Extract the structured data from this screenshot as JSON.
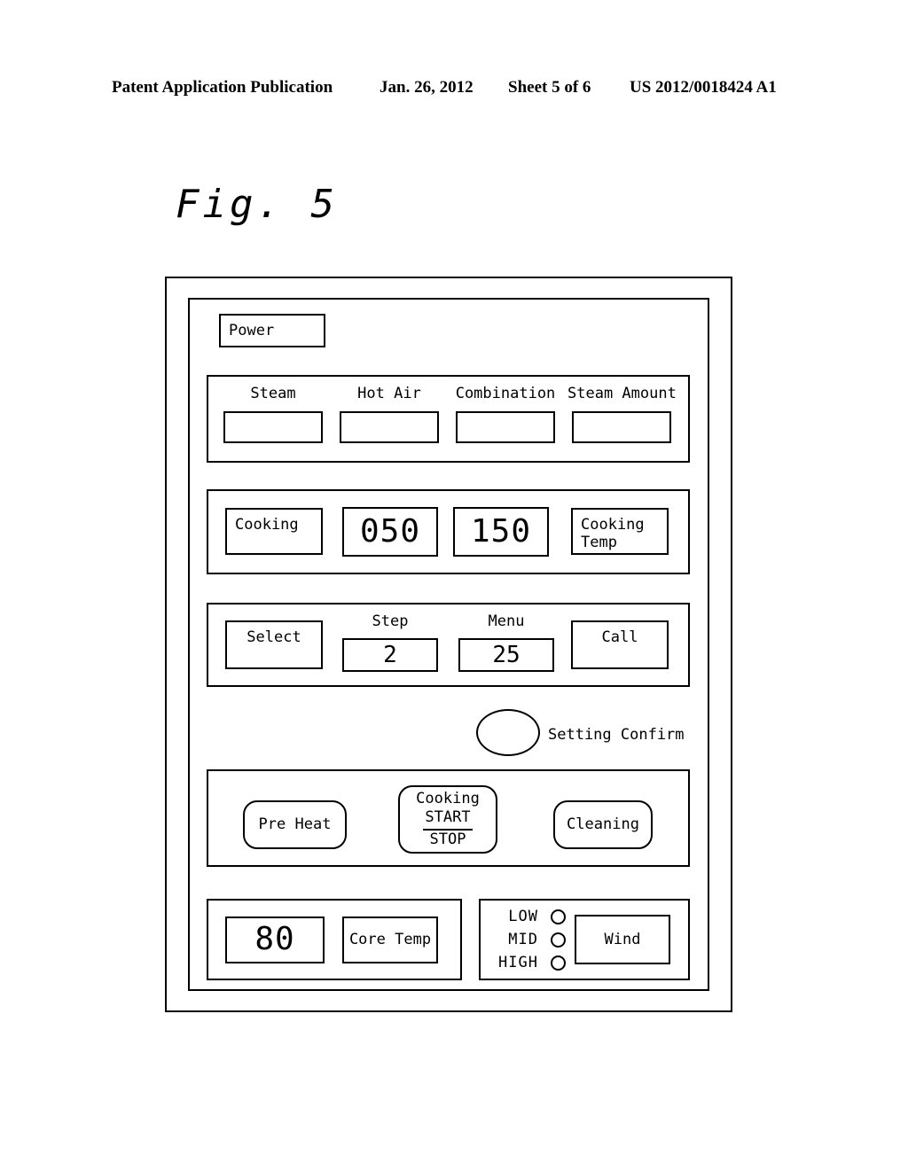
{
  "page_header": {
    "publication": "Patent Application Publication",
    "date": "Jan. 26, 2012",
    "sheet": "Sheet 5 of 6",
    "doc_number": "US 2012/0018424 A1"
  },
  "figure": {
    "label": "Fig.  5"
  },
  "panel": {
    "power": {
      "label": "Power"
    },
    "mode_group": {
      "items": [
        {
          "caption": "Steam",
          "value": ""
        },
        {
          "caption": "Hot Air",
          "value": ""
        },
        {
          "caption": "Combination",
          "value": ""
        },
        {
          "caption": "Steam Amount",
          "value": ""
        }
      ]
    },
    "cooking_group": {
      "cooking_label": "Cooking",
      "time_value": "050",
      "temp_value": "150",
      "cooking_temp_label_line1": "Cooking",
      "cooking_temp_label_line2": "Temp"
    },
    "select_group": {
      "select_label": "Select",
      "step_caption": "Step",
      "step_value": "2",
      "menu_caption": "Menu",
      "menu_value": "25",
      "call_label": "Call"
    },
    "setting_confirm": {
      "lamp_name": "setting-confirm-lamp",
      "label": "Setting Confirm"
    },
    "action_group": {
      "pre_heat_label": "Pre Heat",
      "cooking_start_stop": {
        "line1": "Cooking",
        "line2": "START",
        "line3": "STOP"
      },
      "cleaning_label": "Cleaning"
    },
    "core_temp_group": {
      "value": "80",
      "label": "Core Temp"
    },
    "wind_group": {
      "levels": [
        "LOW",
        "MID",
        "HIGH"
      ],
      "button_label": "Wind"
    }
  },
  "colors": {
    "ink": "#000000",
    "paper": "#ffffff"
  }
}
